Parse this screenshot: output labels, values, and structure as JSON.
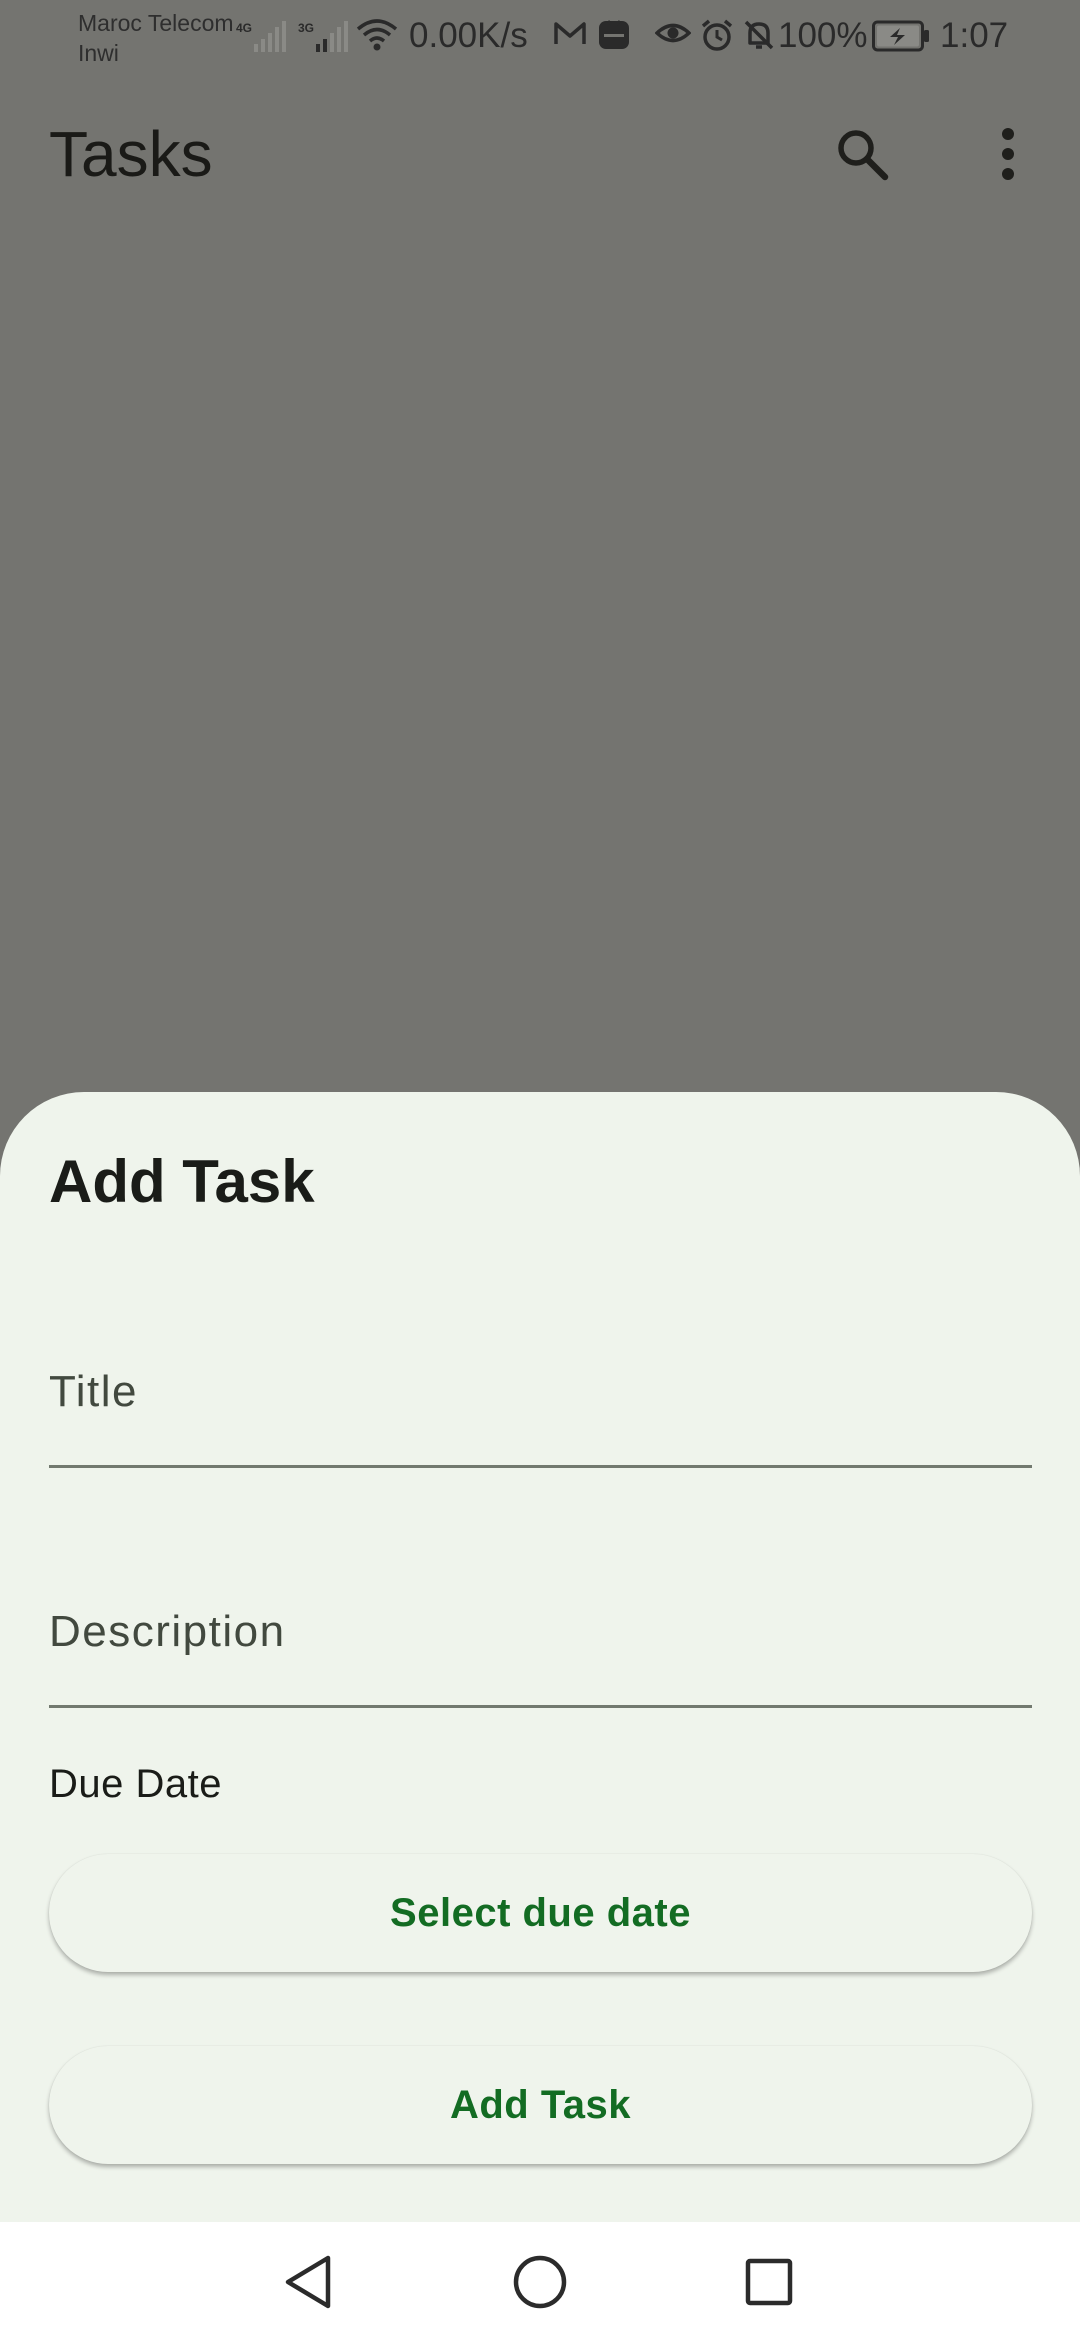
{
  "status_bar": {
    "carrier_1": "Maroc Telecom",
    "carrier_2": "Inwi",
    "network_1": "4G",
    "network_2": "3G",
    "data_speed": "0.00K/s",
    "battery": "100%",
    "time": "1:07",
    "icons": [
      "signal-icon",
      "wifi-icon",
      "gmail-icon",
      "huawei-app-icon",
      "eye-comfort-icon",
      "alarm-icon",
      "mute-icon",
      "battery-charging-icon"
    ]
  },
  "app_bar": {
    "title": "Tasks",
    "actions": [
      "search-icon",
      "more-vert-icon"
    ]
  },
  "sheet": {
    "title": "Add Task",
    "title_field": {
      "placeholder": "Title",
      "value": ""
    },
    "description_field": {
      "placeholder": "Description",
      "value": ""
    },
    "due_date_label": "Due Date",
    "select_due_date_label": "Select due date",
    "add_task_label": "Add Task"
  },
  "nav_bar": {
    "buttons": [
      "back-icon",
      "home-icon",
      "recents-icon"
    ]
  },
  "colors": {
    "scrim": "#747470",
    "sheet_background": "#eff4ec",
    "accent_text": "#136c23"
  }
}
